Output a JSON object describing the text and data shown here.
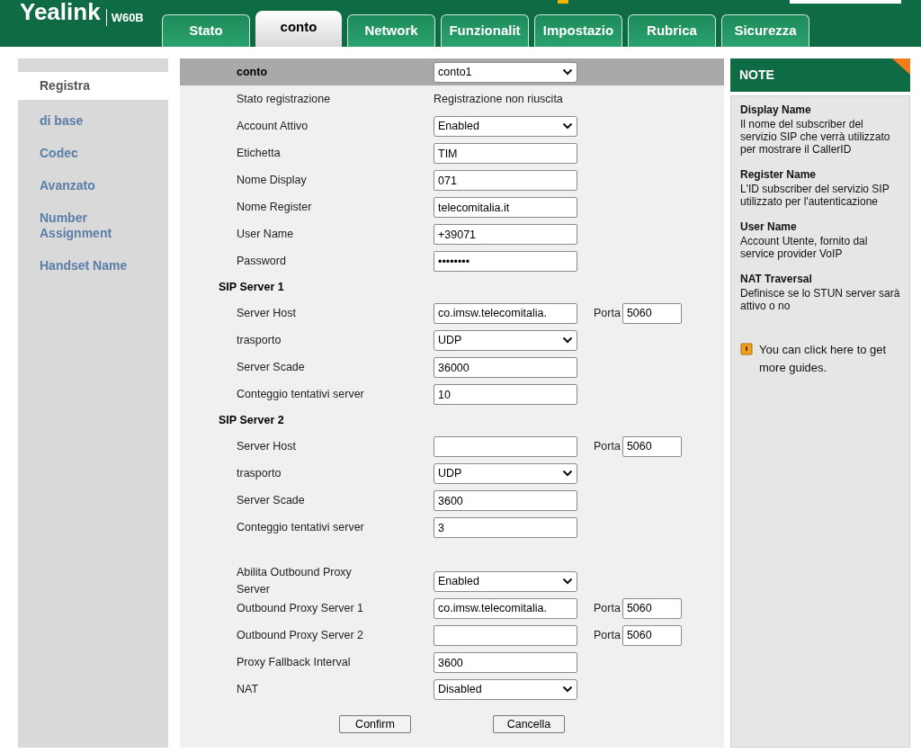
{
  "logo": {
    "brand": "Yealink",
    "model": "W60B"
  },
  "tabs": [
    {
      "label": "Stato",
      "selected": false
    },
    {
      "label": "conto",
      "selected": true
    },
    {
      "label": "Network",
      "selected": false
    },
    {
      "label": "Funzionalit",
      "selected": false
    },
    {
      "label": "Impostazio",
      "selected": false
    },
    {
      "label": "Rubrica",
      "selected": false
    },
    {
      "label": "Sicurezza",
      "selected": false
    }
  ],
  "sidebar": {
    "items": [
      {
        "label": "Registra",
        "selected": true
      },
      {
        "label": "di base",
        "selected": false
      },
      {
        "label": "Codec",
        "selected": false
      },
      {
        "label": "Avanzato",
        "selected": false
      },
      {
        "label": "Number Assignment",
        "selected": false
      },
      {
        "label": "Handset Name",
        "selected": false
      }
    ]
  },
  "form": {
    "rows": [
      {
        "kind": "header",
        "label": "conto",
        "value": "conto1"
      },
      {
        "kind": "text",
        "label": "Stato registrazione",
        "value": "Registrazione non riuscita"
      },
      {
        "kind": "select",
        "label": "Account Attivo",
        "value": "Enabled"
      },
      {
        "kind": "input",
        "label": "Etichetta",
        "value": "TIM"
      },
      {
        "kind": "input",
        "label": "Nome Display",
        "value": "071"
      },
      {
        "kind": "input",
        "label": "Nome Register",
        "value": "telecomitalia.it"
      },
      {
        "kind": "input",
        "label": "User Name",
        "value": "+39071"
      },
      {
        "kind": "password",
        "label": "Password",
        "value": "••••••••"
      },
      {
        "kind": "section",
        "label": "SIP Server 1"
      },
      {
        "kind": "port",
        "label": "Server Host",
        "value": "co.imsw.telecomitalia.",
        "port_label": "Porta",
        "port": "5060"
      },
      {
        "kind": "select",
        "label": "trasporto",
        "value": "UDP"
      },
      {
        "kind": "input",
        "label": "Server Scade",
        "value": "36000"
      },
      {
        "kind": "input",
        "label": "Conteggio tentativi server",
        "value": "10"
      },
      {
        "kind": "section",
        "label": "SIP Server 2"
      },
      {
        "kind": "port",
        "label": "Server Host",
        "value": "",
        "port_label": "Porta",
        "port": "5060"
      },
      {
        "kind": "select",
        "label": "trasporto",
        "value": "UDP"
      },
      {
        "kind": "input",
        "label": "Server Scade",
        "value": "3600"
      },
      {
        "kind": "input",
        "label": "Conteggio tentativi server",
        "value": "3"
      },
      {
        "kind": "spacer"
      },
      {
        "kind": "select",
        "label": "Abilita Outbound Proxy Server",
        "value": "Enabled"
      },
      {
        "kind": "port",
        "label": "Outbound Proxy Server 1",
        "value": "co.imsw.telecomitalia.",
        "port_label": "Porta",
        "port": "5060"
      },
      {
        "kind": "port",
        "label": "Outbound Proxy Server 2",
        "value": "",
        "port_label": "Porta",
        "port": "5060"
      },
      {
        "kind": "input",
        "label": "Proxy Fallback Interval",
        "value": "3600"
      },
      {
        "kind": "select",
        "label": "NAT",
        "value": "Disabled"
      }
    ],
    "buttons": [
      "Confirm",
      "Cancella"
    ]
  },
  "note": {
    "title": "NOTE",
    "entries": [
      {
        "term": "Display Name",
        "text": "Il nome del subscriber del servizio SIP che verrà utilizzato per mostrare il CallerID"
      },
      {
        "term": "Register Name",
        "text": "L'ID subscriber del servizio SIP utilizzato per l'autenticazione"
      },
      {
        "term": "User Name",
        "text": "Account Utente, fornito dal service provider VoIP"
      },
      {
        "term": "NAT Traversal",
        "text": "Definisce se lo STUN server sarà attivo o no"
      }
    ],
    "guide": "You can click here to get more guides."
  }
}
